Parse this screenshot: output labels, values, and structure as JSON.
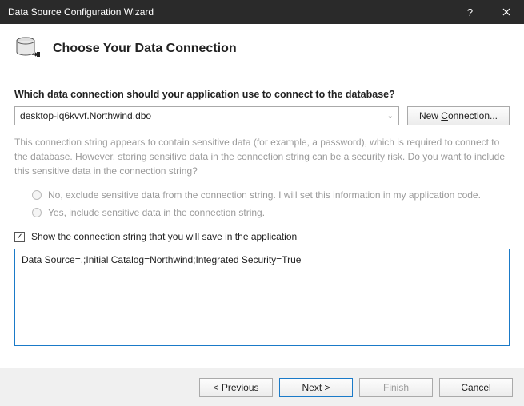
{
  "window": {
    "title": "Data Source Configuration Wizard"
  },
  "header": {
    "title": "Choose Your Data Connection"
  },
  "question": "Which data connection should your application use to connect to the database?",
  "combo": {
    "selected": "desktop-iq6kvvf.Northwind.dbo"
  },
  "buttons": {
    "new_connection": "New Connection..."
  },
  "description": "This connection string appears to contain sensitive data (for example, a password), which is required to connect to the database. However, storing sensitive data in the connection string can be a security risk. Do you want to include this sensitive data in the connection string?",
  "radios": {
    "exclude": "No, exclude sensitive data from the connection string. I will set this information in my application code.",
    "include": "Yes, include sensitive data in the connection string."
  },
  "checkbox": {
    "show_conn": "Show the connection string that you will save in the application"
  },
  "connection_string": "Data Source=.;Initial Catalog=Northwind;Integrated Security=True",
  "footer": {
    "previous": "< Previous",
    "next": "Next >",
    "finish": "Finish",
    "cancel": "Cancel"
  }
}
